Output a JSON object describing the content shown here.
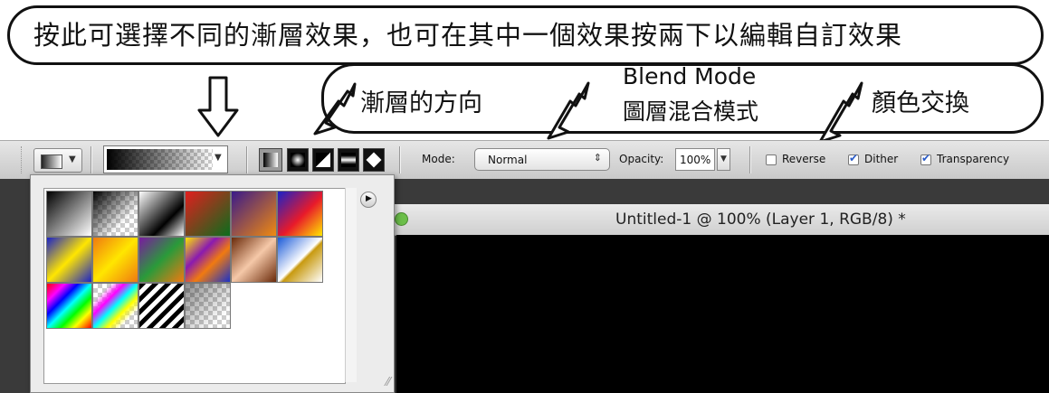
{
  "annotations": {
    "top": "按此可選擇不同的漸層效果，也可在其中一個效果按兩下以編輯自訂效果",
    "direction": "漸層的方向",
    "blend_en": "Blend Mode",
    "blend_zh": "圖層混合模式",
    "color_swap": "顏色交換"
  },
  "toolbar": {
    "mode_label": "Mode:",
    "mode_value": "Normal",
    "opacity_label": "Opacity:",
    "opacity_value": "100%",
    "reverse_label": "Reverse",
    "dither_label": "Dither",
    "transparency_label": "Transparency",
    "reverse_checked": false,
    "dither_checked": true,
    "transparency_checked": true,
    "gradient_types": [
      "linear",
      "radial",
      "angle",
      "reflected",
      "diamond"
    ]
  },
  "document": {
    "title": "Untitled-1 @ 100% (Layer 1, RGB/8) *"
  },
  "picker": {
    "swatches": [
      "black-white",
      "black-transparent",
      "black-white-diagonal",
      "red-green",
      "violet-orange",
      "blue-red-yellow",
      "blue-yellow-blue",
      "orange-yellow-orange",
      "violet-green-orange",
      "yellow-violet-orange-blue",
      "copper",
      "chrome",
      "spectrum",
      "transparent-rainbow",
      "transparent-stripes",
      "neutral-density"
    ]
  },
  "colors": {
    "accent_check": "#2a5cc8",
    "canvas": "#000000"
  }
}
